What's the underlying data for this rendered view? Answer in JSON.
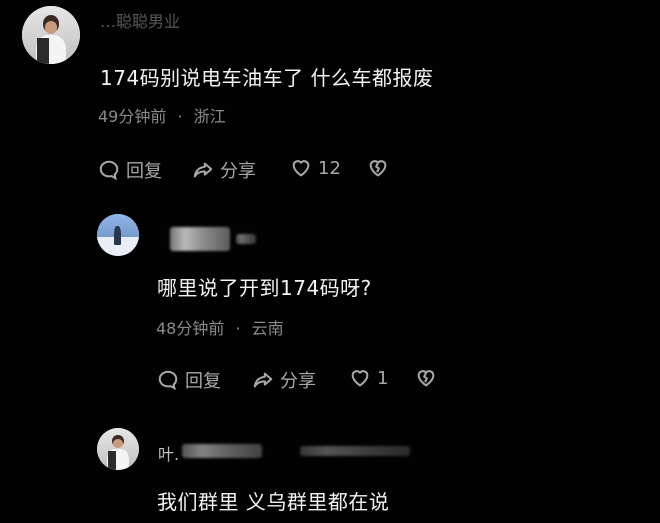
{
  "comments": [
    {
      "username": "…聪聪男业",
      "text": "174码别说电车油车了 什么车都报废",
      "time": "49分钟前",
      "location": "浙江",
      "reply_label": "回复",
      "share_label": "分享",
      "like_count": "12"
    },
    {
      "username": "",
      "text": "哪里说了开到174码呀?",
      "time": "48分钟前",
      "location": "云南",
      "reply_label": "回复",
      "share_label": "分享",
      "like_count": "1"
    },
    {
      "username": "叶.",
      "text": "我们群里 义乌群里都在说",
      "time": "",
      "location": "",
      "reply_label": "",
      "share_label": "",
      "like_count": ""
    }
  ],
  "meta_separator": "·",
  "icons": {
    "reply": "speech-bubble-icon",
    "share": "share-arrow-icon",
    "like": "heart-icon",
    "dislike": "broken-heart-icon"
  },
  "colors": {
    "background": "#020202",
    "text_primary": "#f3f3f3",
    "text_secondary": "#8a8a8a",
    "icon_gray": "#a8a8a8"
  }
}
